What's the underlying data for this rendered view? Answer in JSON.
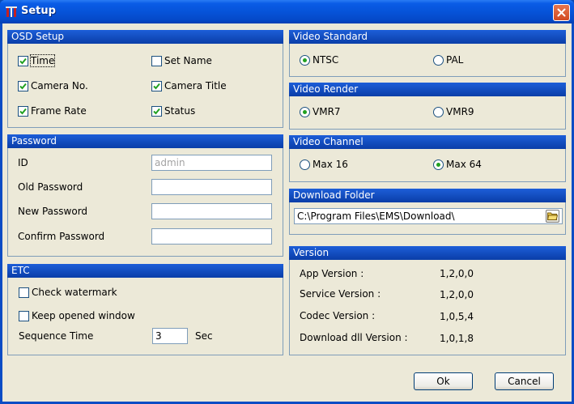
{
  "window": {
    "title": "Setup"
  },
  "osd": {
    "header": "OSD Setup",
    "items": [
      {
        "label": "Time",
        "checked": true
      },
      {
        "label": "Set Name",
        "checked": false
      },
      {
        "label": "Camera No.",
        "checked": true
      },
      {
        "label": "Camera Title",
        "checked": true
      },
      {
        "label": "Frame Rate",
        "checked": true
      },
      {
        "label": "Status",
        "checked": true
      }
    ]
  },
  "password": {
    "header": "Password",
    "id_label": "ID",
    "id_value": "admin",
    "old_label": "Old Password",
    "new_label": "New Password",
    "confirm_label": "Confirm Password"
  },
  "etc": {
    "header": "ETC",
    "check_watermark": "Check watermark",
    "keep_opened": "Keep opened window",
    "sequence_label": "Sequence Time",
    "sequence_value": "3",
    "sequence_unit": "Sec"
  },
  "video_standard": {
    "header": "Video Standard",
    "options": [
      "NTSC",
      "PAL"
    ],
    "selected": "NTSC"
  },
  "video_render": {
    "header": "Video Render",
    "options": [
      "VMR7",
      "VMR9"
    ],
    "selected": "VMR7"
  },
  "video_channel": {
    "header": "Video Channel",
    "options": [
      "Max 16",
      "Max 64"
    ],
    "selected": "Max 64"
  },
  "download_folder": {
    "header": "Download Folder",
    "path": "C:\\Program Files\\EMS\\Download\\"
  },
  "version": {
    "header": "Version",
    "rows": [
      {
        "label": "App Version :",
        "value": "1,2,0,0"
      },
      {
        "label": "Service Version :",
        "value": "1,2,0,0"
      },
      {
        "label": "Codec Version :",
        "value": "1,0,5,4"
      },
      {
        "label": "Download dll Version :",
        "value": "1,0,1,8"
      }
    ]
  },
  "buttons": {
    "ok": "Ok",
    "cancel": "Cancel"
  },
  "colors": {
    "titlebar": "#0653d9",
    "panel_header": "#1d5ed8",
    "radio_dot": "#21a121",
    "close": "#d24a21"
  }
}
